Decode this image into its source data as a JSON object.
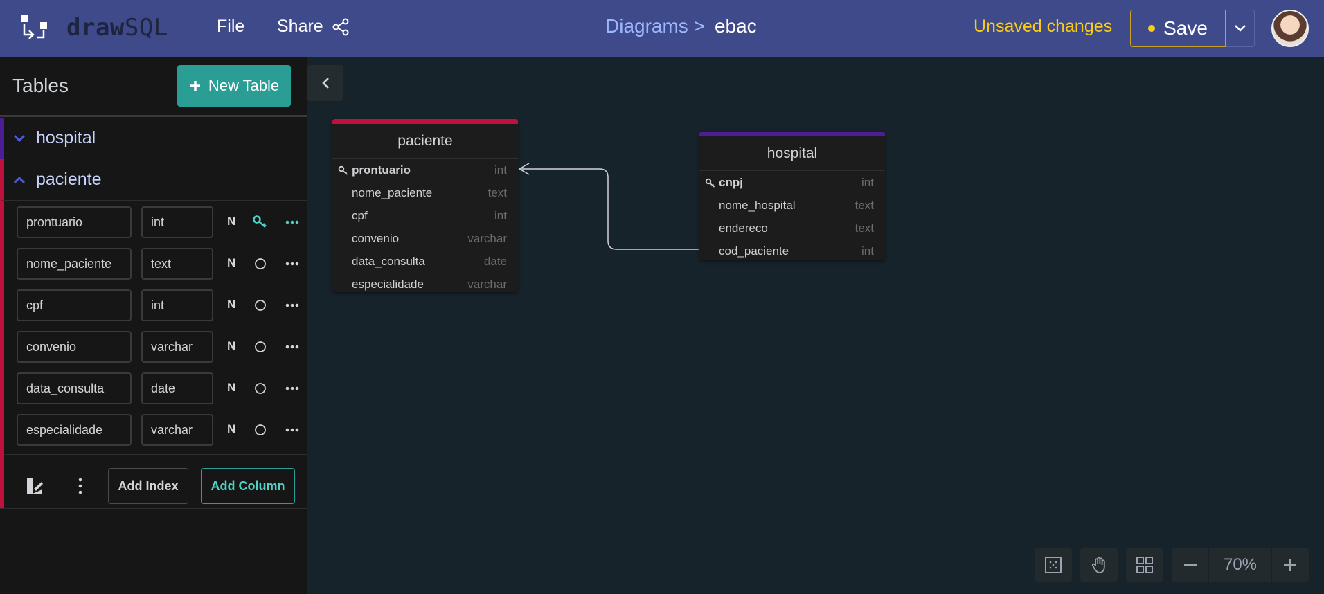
{
  "app": {
    "brand_bold": "draw",
    "brand_rest": "SQL",
    "menu": {
      "file": "File",
      "share": "Share"
    },
    "breadcrumb": {
      "parent": "Diagrams >",
      "current": "ebac"
    },
    "status": "Unsaved changes",
    "save_label": "Save",
    "colors": {
      "accent": "#2a9d95",
      "topbar": "#3f4a8a",
      "warning": "#facc15",
      "hospital": "#4c1d95",
      "paciente": "#be123c"
    }
  },
  "sidebar": {
    "title": "Tables",
    "new_table": "New Table",
    "tables": [
      {
        "name": "hospital",
        "expanded": false
      },
      {
        "name": "paciente",
        "expanded": true
      }
    ],
    "columns": [
      {
        "name": "prontuario",
        "type": "int",
        "nullable": "N",
        "primary": true
      },
      {
        "name": "nome_paciente",
        "type": "text",
        "nullable": "N",
        "primary": false
      },
      {
        "name": "cpf",
        "type": "int",
        "nullable": "N",
        "primary": false
      },
      {
        "name": "convenio",
        "type": "varchar",
        "nullable": "N",
        "primary": false
      },
      {
        "name": "data_consulta",
        "type": "date",
        "nullable": "N",
        "primary": false
      },
      {
        "name": "especialidade",
        "type": "varchar",
        "nullable": "N",
        "primary": false
      }
    ],
    "add_index": "Add Index",
    "add_column": "Add Column"
  },
  "diagram": {
    "entities": [
      {
        "name": "paciente",
        "fields": [
          {
            "name": "prontuario",
            "type": "int",
            "pk": true
          },
          {
            "name": "nome_paciente",
            "type": "text",
            "pk": false
          },
          {
            "name": "cpf",
            "type": "int",
            "pk": false
          },
          {
            "name": "convenio",
            "type": "varchar",
            "pk": false
          },
          {
            "name": "data_consulta",
            "type": "date",
            "pk": false
          },
          {
            "name": "especialidade",
            "type": "varchar",
            "pk": false
          }
        ]
      },
      {
        "name": "hospital",
        "fields": [
          {
            "name": "cnpj",
            "type": "int",
            "pk": true
          },
          {
            "name": "nome_hospital",
            "type": "text",
            "pk": false
          },
          {
            "name": "endereco",
            "type": "text",
            "pk": false
          },
          {
            "name": "cod_paciente",
            "type": "int",
            "pk": false
          }
        ]
      }
    ]
  },
  "zoom": {
    "level": "70%"
  }
}
